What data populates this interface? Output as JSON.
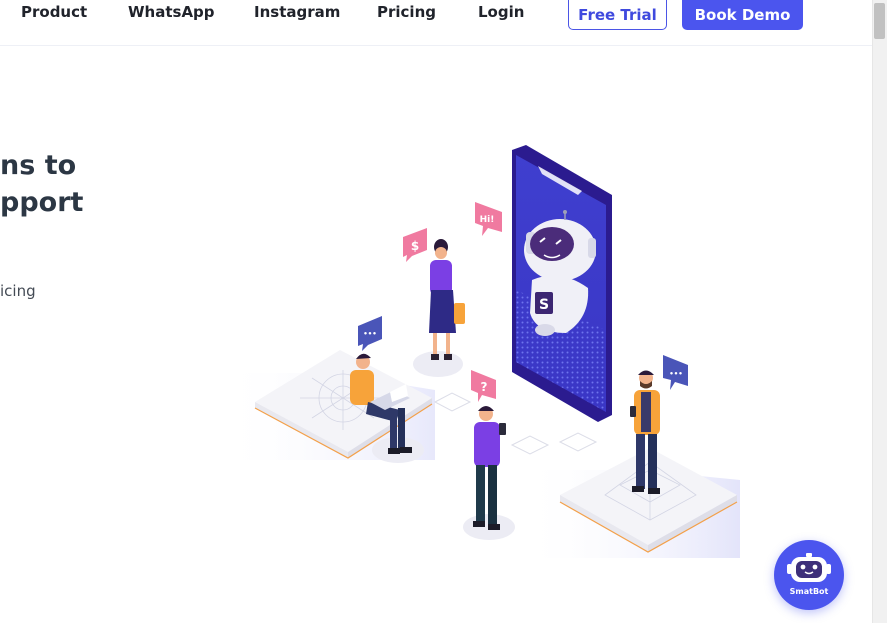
{
  "nav": {
    "links": [
      "Product",
      "WhatsApp",
      "Instagram",
      "Pricing",
      "Login"
    ],
    "free_trial": "Free Trial",
    "book_demo": "Book Demo"
  },
  "hero": {
    "title_line1": "ns to",
    "title_line2": "pport",
    "subtitle": "icing"
  },
  "illustration": {
    "bubble_hi": "Hi!",
    "bubble_dollar": "$",
    "bubble_question": "?",
    "bubble_dots": "•••",
    "robot_badge": "S"
  },
  "chatbot": {
    "label": "SmatBot"
  },
  "colors": {
    "accent": "#4b55ee",
    "heading": "#2c3744",
    "phone": "#2f1a9e",
    "bubble_pink": "#f07aa0",
    "bubble_blue": "#4a55b8",
    "orange": "#f7a33a"
  }
}
